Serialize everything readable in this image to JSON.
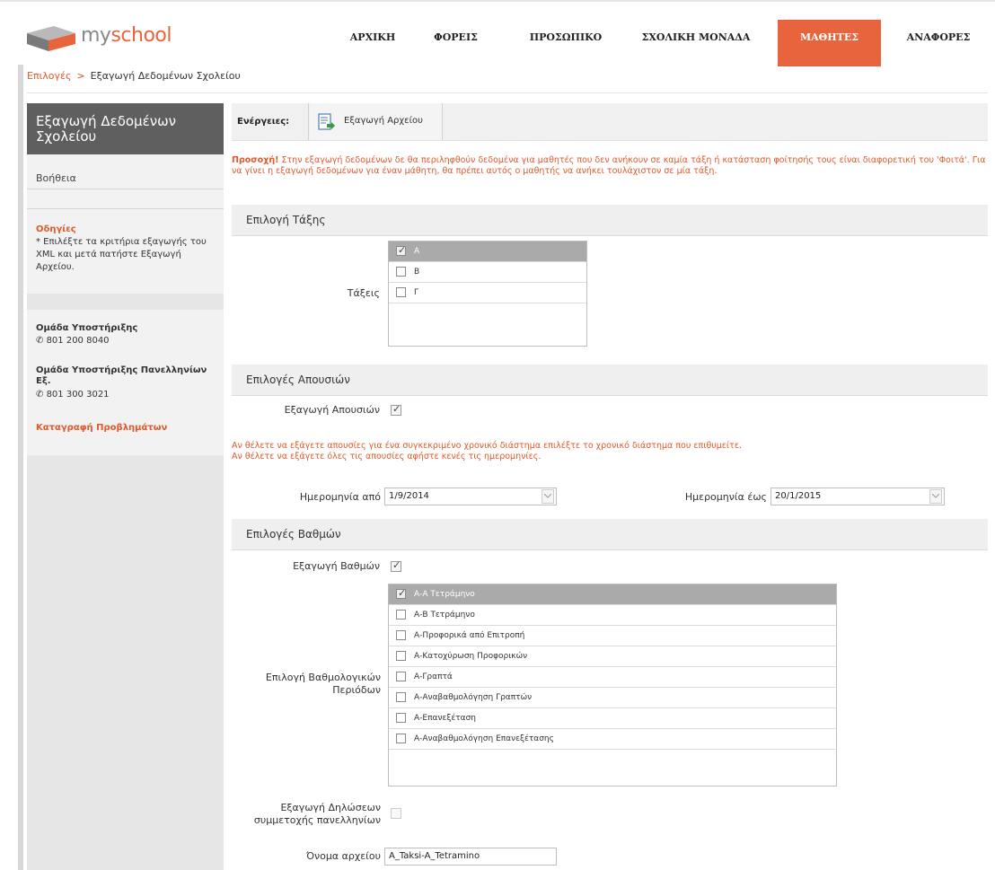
{
  "header": {
    "logo": {
      "my": "my",
      "school": "school"
    },
    "nav": [
      {
        "label": "ΑΡΧΙΚΗ",
        "active": false
      },
      {
        "label": "ΦΟΡΕΙΣ",
        "active": false
      },
      {
        "label": "ΠΡΟΣΩΠΙΚΟ",
        "active": false
      },
      {
        "label": "ΣΧΟΛΙΚΗ ΜΟΝΑΔΑ",
        "active": false
      },
      {
        "label": "ΜΑΘΗΤΕΣ",
        "active": true
      },
      {
        "label": "ΑΝΑΦΟΡΕΣ",
        "active": false
      }
    ],
    "accent_color": "#e8643c"
  },
  "breadcrumb": {
    "parent": "Επιλογές",
    "separator": ">",
    "current": "Εξαγωγή Δεδομένων Σχολείου"
  },
  "sidebar": {
    "title": "Εξαγωγή Δεδομένων Σχολείου",
    "help": "Βοήθεια",
    "instructions_title": "Οδηγίες",
    "instructions_text": "* Επιλέξτε τα κριτήρια εξαγωγής του XML και μετά πατήστε Εξαγωγή Αρχείου.",
    "support": [
      {
        "title": "Ομάδα Υποστήριξης",
        "phone": "801 200 8040"
      },
      {
        "title": "Ομάδα Υποστήριξης Πανελληνίων Εξ.",
        "phone": "801 300 3021"
      }
    ],
    "report_link": "Καταγραφή Προβλημάτων"
  },
  "toolbar": {
    "label": "Ενέργειες:",
    "export_button": "Εξαγωγή Αρχείου"
  },
  "warning": {
    "bold": "Προσοχή!",
    "text": " Στην εξαγωγή δεδομένων δε θα περιληφθούν δεδομένα για μαθητές που δεν ανήκουν σε καμία τάξη ή κατάσταση φοίτησής τους είναι διαφορετική του 'Φοιτά'. Για να γίνει η εξαγωγή δεδομένων για έναν μάθητη, θα πρέπει αυτός ο μαθητής να ανήκει τουλάχιστον σε μία τάξη."
  },
  "class_section": {
    "title": "Επιλογή Τάξης",
    "field_label": "Τάξεις",
    "items": [
      {
        "label": "Α",
        "checked": true
      },
      {
        "label": "Β",
        "checked": false
      },
      {
        "label": "Γ",
        "checked": false
      }
    ]
  },
  "absence_section": {
    "title": "Επιλογές Απουσιών",
    "export_label": "Εξαγωγή Απουσιών",
    "export_checked": true,
    "info_line1": "Αν θέλετε να εξάγετε απουσίες για ένα συγκεκριμένο χρονικό διάστημα επιλέξτε το χρονικό διάστημα που επιθυμείτε.",
    "info_line2": "Αν θέλετε να εξάγετε όλες τις απουσίες αφήστε κενές τις ημερομηνίες.",
    "date_from_label": "Ημερομηνία από",
    "date_from_value": "1/9/2014",
    "date_to_label": "Ημερομηνία έως",
    "date_to_value": "20/1/2015"
  },
  "grades_section": {
    "title": "Επιλογές Βαθμών",
    "export_label": "Εξαγωγή Βαθμών",
    "export_checked": true,
    "periods_label_line1": "Επιλογή Βαθμολογικών",
    "periods_label_line2": "Περιόδων",
    "periods": [
      {
        "label": "Α-Α Τετράμηνο",
        "checked": true
      },
      {
        "label": "Α-Β Τετράμηνο",
        "checked": false
      },
      {
        "label": "Α-Προφορικά από Επιτροπή",
        "checked": false
      },
      {
        "label": "Α-Κατοχύρωση Προφορικών",
        "checked": false
      },
      {
        "label": "Α-Γραπτά",
        "checked": false
      },
      {
        "label": "Α-Αναβαθμολόγηση Γραπτών",
        "checked": false
      },
      {
        "label": "Α-Επανεξέταση",
        "checked": false
      },
      {
        "label": "Α-Αναβαθμολόγηση Επανεξέτασης",
        "checked": false
      }
    ],
    "declarations_label_line1": "Εξαγωγή Δηλώσεων",
    "declarations_label_line2": "συμμετοχής πανελληνίων",
    "declarations_checked": false,
    "filename_label": "Όνομα αρχείου",
    "filename_value": "A_Taksi-A_Tetramino"
  }
}
